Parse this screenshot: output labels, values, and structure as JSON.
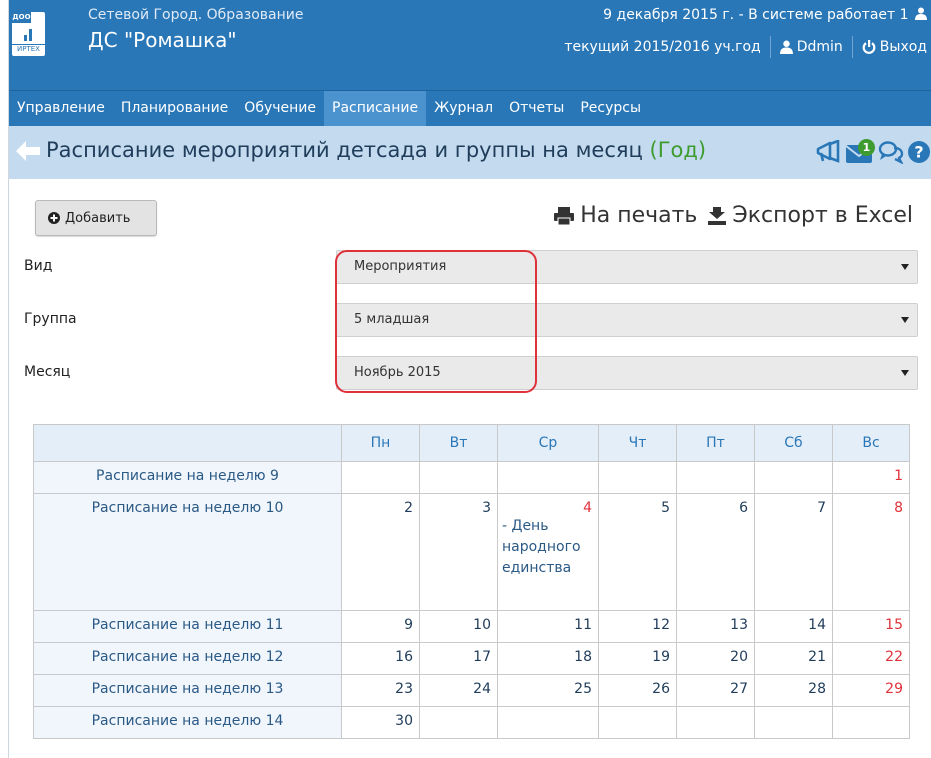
{
  "header": {
    "logo_tag": "ДОО",
    "logo_word": "ИРТЕХ",
    "system_name": "Сетевой Город. Образование",
    "org_name": "ДС \"Ромашка\"",
    "date_status": "9 декабря 2015 г. - В системе работает 1",
    "academic_year": "текущий 2015/2016 уч.год",
    "user": "Ddmin",
    "logout": "Выход"
  },
  "nav": {
    "items": [
      "Управление",
      "Планирование",
      "Обучение",
      "Расписание",
      "Журнал",
      "Отчеты",
      "Ресурсы"
    ],
    "active": "Расписание"
  },
  "page": {
    "title": "Расписание мероприятий детсада и группы на месяц",
    "title_link": "(Год)",
    "notification_count": "1"
  },
  "toolbar": {
    "add_label": "Добавить",
    "print_label": "На печать",
    "export_label": "Экспорт в Excel"
  },
  "filters": [
    {
      "label": "Вид",
      "value": "Мероприятия"
    },
    {
      "label": "Группа",
      "value": "5 младшая"
    },
    {
      "label": "Месяц",
      "value": "Ноябрь 2015"
    }
  ],
  "calendar": {
    "days": [
      "Пн",
      "Вт",
      "Ср",
      "Чт",
      "Пт",
      "Сб",
      "Вс"
    ],
    "weeks": [
      {
        "label": "Расписание на неделю 9",
        "cells": [
          "",
          "",
          "",
          "",
          "",
          "",
          "1"
        ]
      },
      {
        "label": "Расписание на неделю 10",
        "cells": [
          "2",
          "3",
          "4",
          "5",
          "6",
          "7",
          "8"
        ],
        "event_day": 2,
        "event_text": [
          "- День",
          "народного",
          "единства"
        ]
      },
      {
        "label": "Расписание на неделю 11",
        "cells": [
          "9",
          "10",
          "11",
          "12",
          "13",
          "14",
          "15"
        ]
      },
      {
        "label": "Расписание на неделю 12",
        "cells": [
          "16",
          "17",
          "18",
          "19",
          "20",
          "21",
          "22"
        ]
      },
      {
        "label": "Расписание на неделю 13",
        "cells": [
          "23",
          "24",
          "25",
          "26",
          "27",
          "28",
          "29"
        ]
      },
      {
        "label": "Расписание на неделю 14",
        "cells": [
          "30",
          "",
          "",
          "",
          "",
          "",
          ""
        ]
      }
    ],
    "holiday_color": "#e0313a"
  },
  "colors": {
    "header_bg": "#2a77b8",
    "titlebar_bg": "#c4dbef",
    "year_link": "#3e9b2f",
    "highlight": "#e0313a"
  }
}
